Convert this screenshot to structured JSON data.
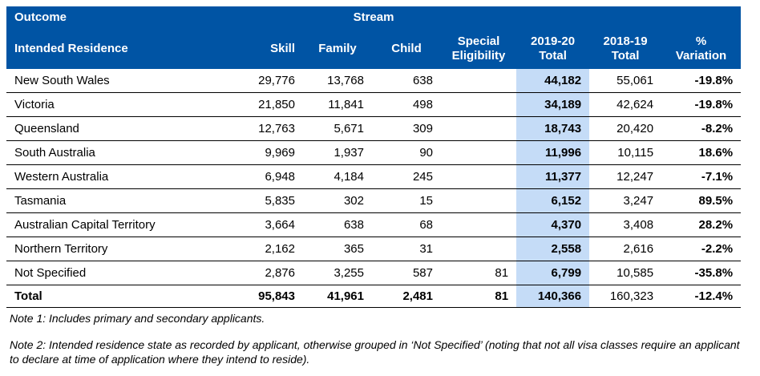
{
  "table": {
    "header": {
      "outcome": "Outcome",
      "stream": "Stream",
      "intended_residence": "Intended Residence",
      "skill": "Skill",
      "family": "Family",
      "child": "Child",
      "special_line1": "Special",
      "special_line2": "Eligibility",
      "cur_line1": "2019-20",
      "cur_line2": "Total",
      "prev_line1": "2018-19",
      "prev_line2": "Total",
      "var_line1": "%",
      "var_line2": "Variation"
    },
    "rows": [
      {
        "name": "New South Wales",
        "skill": "29,776",
        "family": "13,768",
        "child": "638",
        "special": "",
        "cur": "44,182",
        "prev": "55,061",
        "var": "-19.8%"
      },
      {
        "name": "Victoria",
        "skill": "21,850",
        "family": "11,841",
        "child": "498",
        "special": "",
        "cur": "34,189",
        "prev": "42,624",
        "var": "-19.8%"
      },
      {
        "name": "Queensland",
        "skill": "12,763",
        "family": "5,671",
        "child": "309",
        "special": "",
        "cur": "18,743",
        "prev": "20,420",
        "var": "-8.2%"
      },
      {
        "name": "South Australia",
        "skill": "9,969",
        "family": "1,937",
        "child": "90",
        "special": "",
        "cur": "11,996",
        "prev": "10,115",
        "var": "18.6%"
      },
      {
        "name": "Western Australia",
        "skill": "6,948",
        "family": "4,184",
        "child": "245",
        "special": "",
        "cur": "11,377",
        "prev": "12,247",
        "var": "-7.1%"
      },
      {
        "name": "Tasmania",
        "skill": "5,835",
        "family": "302",
        "child": "15",
        "special": "",
        "cur": "6,152",
        "prev": "3,247",
        "var": "89.5%"
      },
      {
        "name": "Australian Capital Territory",
        "skill": "3,664",
        "family": "638",
        "child": "68",
        "special": "",
        "cur": "4,370",
        "prev": "3,408",
        "var": "28.2%"
      },
      {
        "name": "Northern Territory",
        "skill": "2,162",
        "family": "365",
        "child": "31",
        "special": "",
        "cur": "2,558",
        "prev": "2,616",
        "var": "-2.2%"
      },
      {
        "name": "Not Specified",
        "skill": "2,876",
        "family": "3,255",
        "child": "587",
        "special": "81",
        "cur": "6,799",
        "prev": "10,585",
        "var": "-35.8%"
      }
    ],
    "total": {
      "name": "Total",
      "skill": "95,843",
      "family": "41,961",
      "child": "2,481",
      "special": "81",
      "cur": "140,366",
      "prev": "160,323",
      "var": "-12.4%"
    }
  },
  "notes": {
    "note1": "Note 1: Includes primary and secondary applicants.",
    "note2": "Note 2: Intended residence state as recorded by applicant, otherwise grouped in ‘Not Specified’ (noting that not all visa classes require an applicant to declare at time of application where they intend to reside)."
  },
  "colors": {
    "header_bg": "#0054a4",
    "header_text": "#ffffff",
    "highlight_col": "#c5dcf7"
  }
}
